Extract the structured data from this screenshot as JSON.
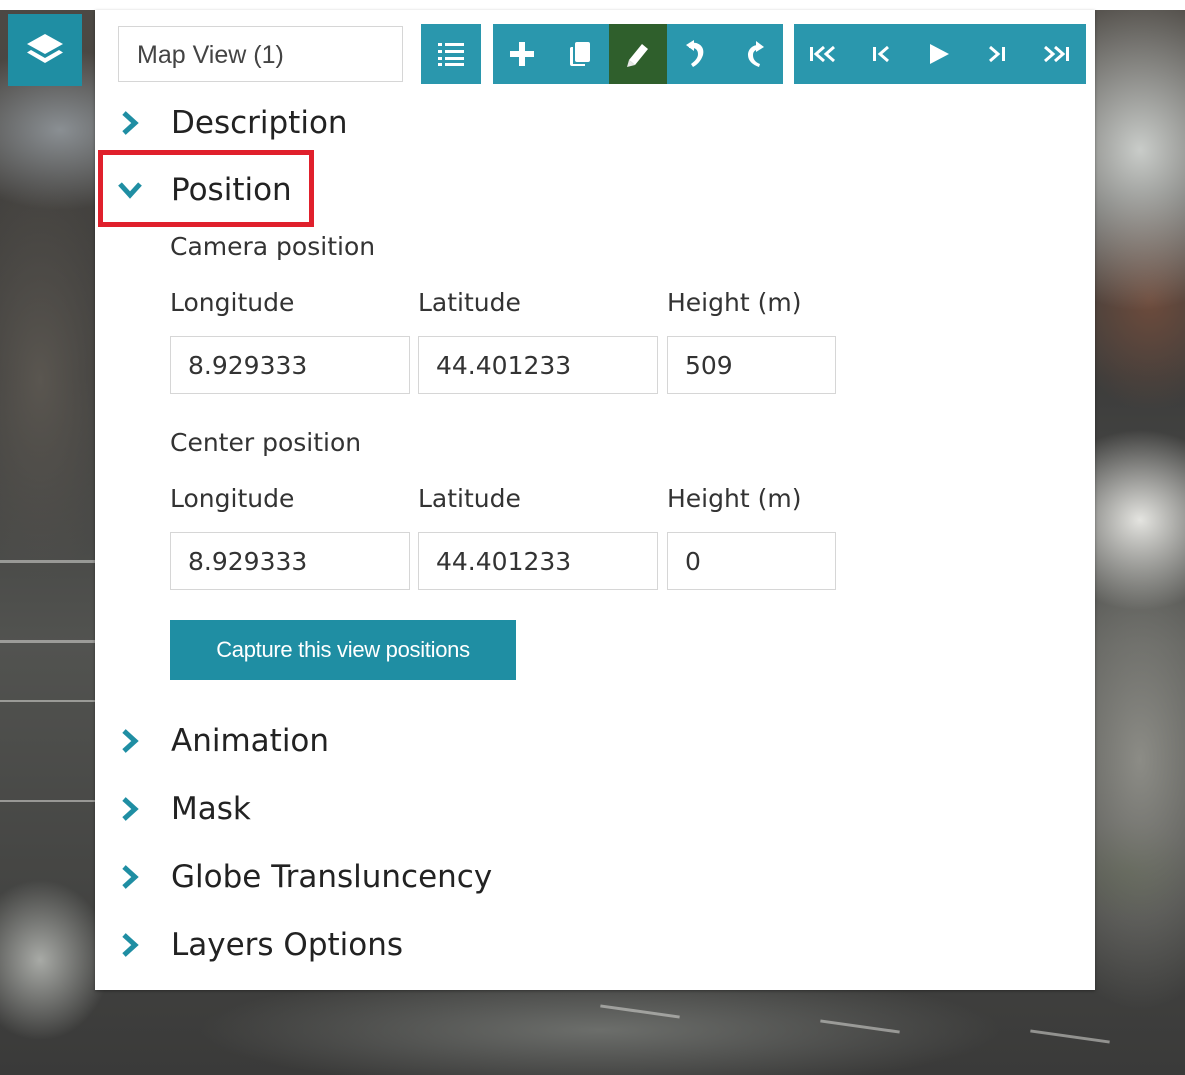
{
  "toolbar": {
    "view_name": "Map View (1)",
    "buttons": [
      "list-icon",
      "plus-icon",
      "copy-icon",
      "edit-icon",
      "undo-icon",
      "redo-icon",
      "first-icon",
      "previous-icon",
      "play-icon",
      "next-icon",
      "last-icon"
    ]
  },
  "sections": {
    "description": "Description",
    "position": "Position",
    "animation": "Animation",
    "mask": "Mask",
    "globe_translucency": "Globe Transluncency",
    "layers_options": "Layers Options"
  },
  "camera": {
    "title": "Camera position",
    "longitude_label": "Longitude",
    "latitude_label": "Latitude",
    "height_label": "Height (m)",
    "longitude": "8.929333",
    "latitude": "44.401233",
    "height": "509"
  },
  "center": {
    "title": "Center position",
    "longitude_label": "Longitude",
    "latitude_label": "Latitude",
    "height_label": "Height (m)",
    "longitude": "8.929333",
    "latitude": "44.401233",
    "height": "0"
  },
  "capture_button": "Capture this view positions",
  "colors": {
    "accent": "#1f8ea3",
    "toolbar": "#2a97ad",
    "active_tool": "#2f5f2c",
    "highlight": "#e0202c"
  }
}
